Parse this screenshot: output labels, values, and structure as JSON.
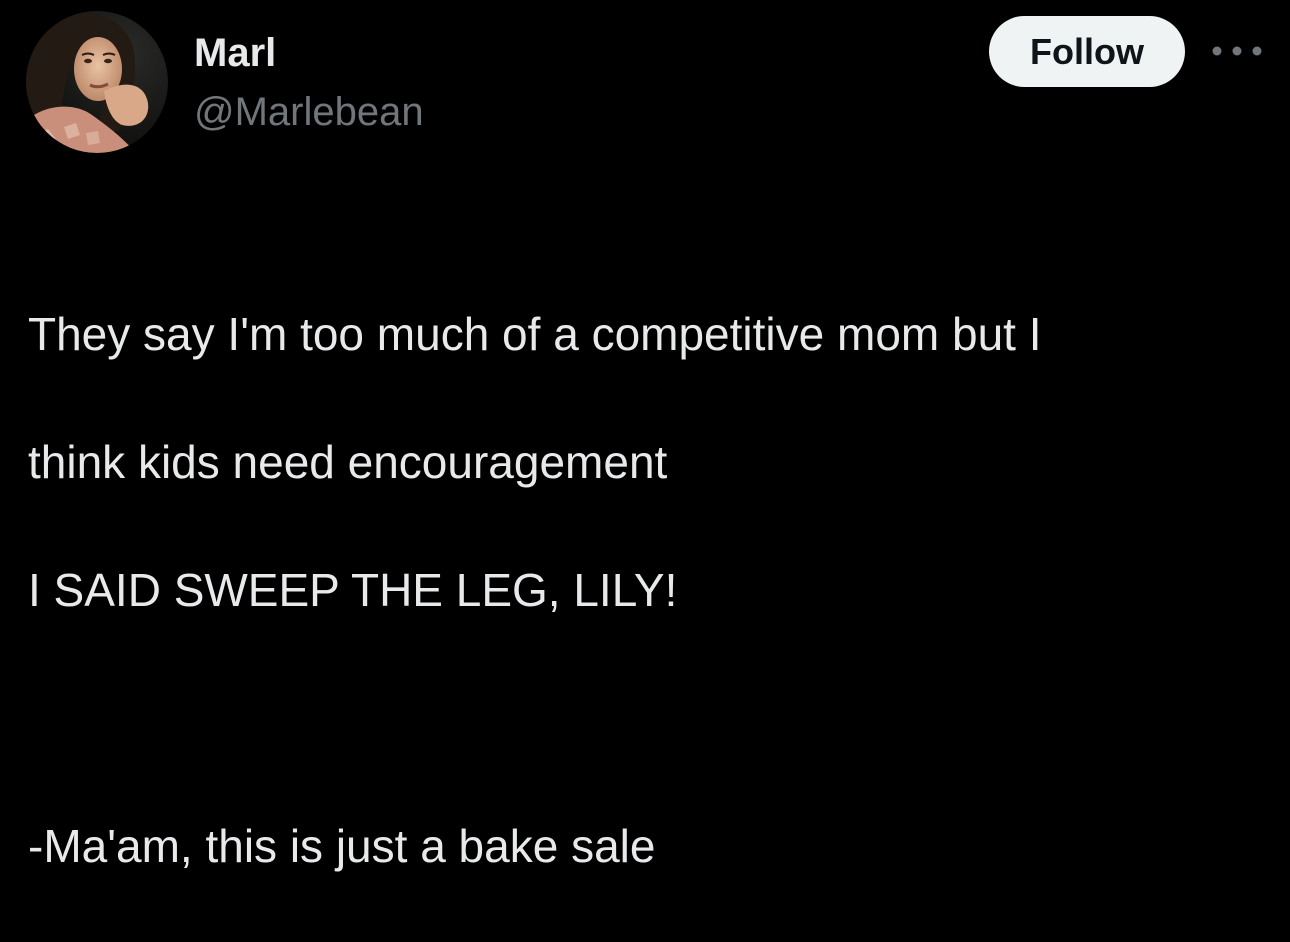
{
  "author": {
    "display_name": "Marl",
    "handle": "@Marlebean",
    "avatar_icon": "profile-photo"
  },
  "actions": {
    "follow_label": "Follow",
    "more_icon": "more-dots-icon"
  },
  "tweet": {
    "lines": [
      "They say I'm too much of a competitive mom but I",
      "think kids need encouragement",
      "I SAID SWEEP THE LEG, LILY!",
      "",
      "-Ma'am, this is just a bake sale"
    ]
  },
  "colors": {
    "background": "#000000",
    "primary_text": "#e7e9ea",
    "secondary_text": "#71767b",
    "follow_button_bg": "#eff3f4",
    "follow_button_text": "#0f1419"
  }
}
